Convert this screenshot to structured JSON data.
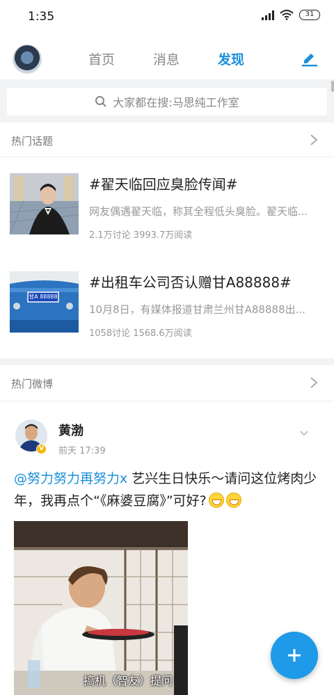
{
  "status_bar": {
    "time": "1:35",
    "battery": "31"
  },
  "nav": {
    "tabs": [
      "首页",
      "消息",
      "发现"
    ],
    "active_tab": "发现"
  },
  "search": {
    "placeholder": "大家都在搜:马思纯工作室"
  },
  "hot_topics": {
    "title": "热门话题",
    "items": [
      {
        "title": "#翟天临回应臭脸传闻#",
        "desc": "网友偶遇翟天临，称其全程低头臭脸。翟天临...",
        "stats": "2.1万讨论 3993.7万阅读"
      },
      {
        "title": "#出租车公司否认赠甘A88888#",
        "desc": "10月8日，有媒体报道甘肃兰州甘A88888出...",
        "stats": "1058讨论 1568.6万阅读",
        "plate": "甘A 88888"
      }
    ]
  },
  "hot_weibo": {
    "title": "热门微博",
    "post": {
      "author": "黄渤",
      "time": "前天 17:39",
      "mention": "@努力努力再努力x",
      "text": " 艺兴生日快乐～请问这位烤肉少年，我再点个“《麻婆豆腐》”可好?",
      "image_caption": "搞机（智友）提问"
    }
  },
  "colors": {
    "accent": "#1a8fd9",
    "fab": "#1e9ae8"
  }
}
